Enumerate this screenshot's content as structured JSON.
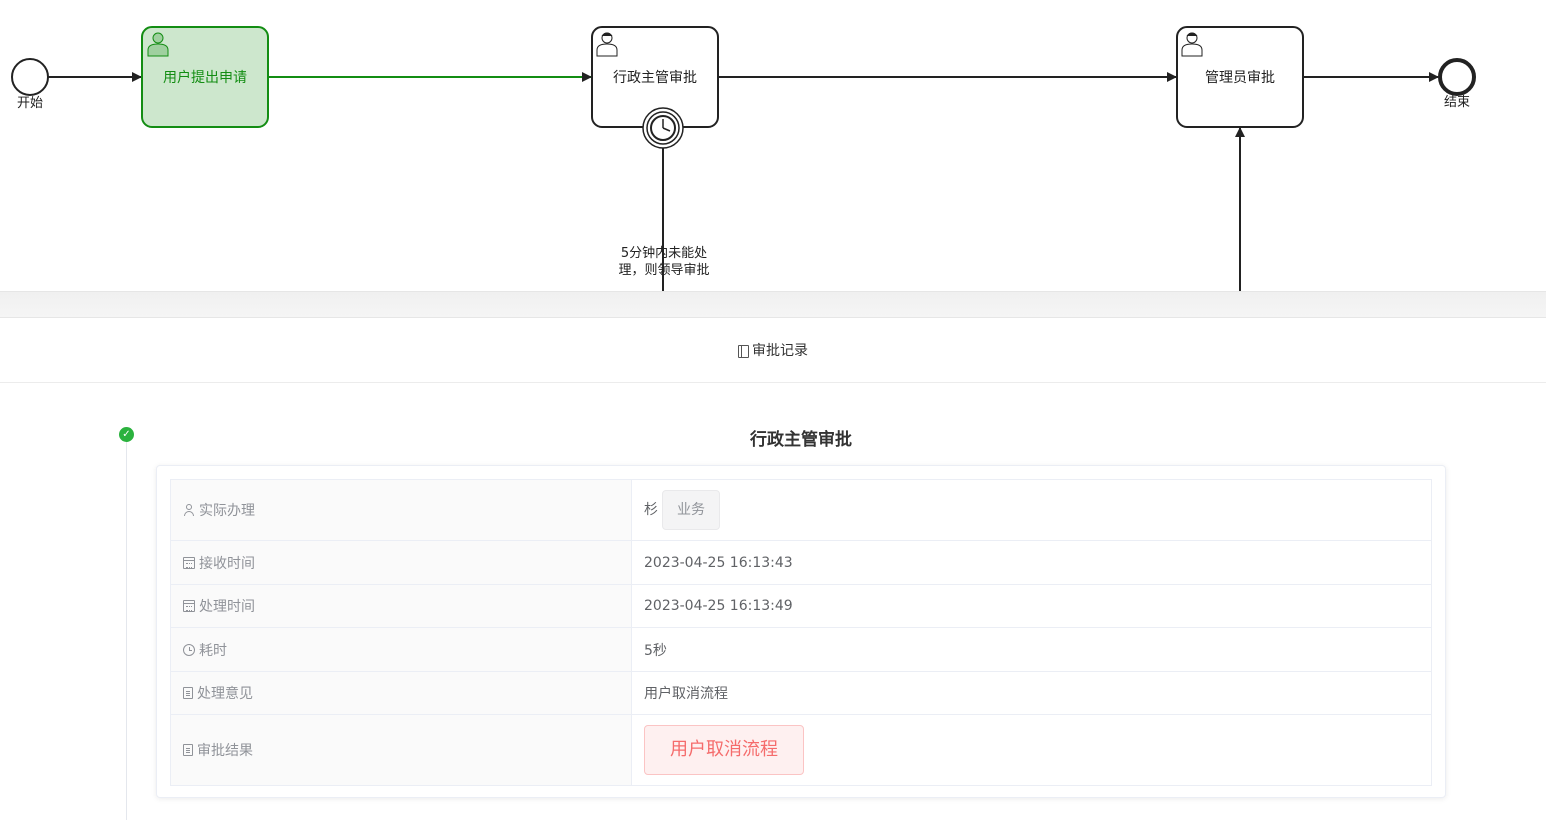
{
  "diagram": {
    "start_label": "开始",
    "end_label": "结束",
    "tasks": [
      {
        "label": "用户提出申请",
        "status": "completed"
      },
      {
        "label": "行政主管审批",
        "status": "pending"
      },
      {
        "label": "管理员审批",
        "status": "pending"
      }
    ],
    "timer_flow_label_line1": "5分钟内未能处",
    "timer_flow_label_line2": "理，则领导审批",
    "colors": {
      "completed_fill": "#cde7cd",
      "completed_stroke": "#138d13",
      "stroke": "#222222"
    }
  },
  "record": {
    "header_icon": "document-icon",
    "header": "审批记录",
    "node_title": "行政主管审批",
    "status_icon": "check-circle-icon",
    "rows": {
      "handler_label": "实际办理",
      "handler_name": "杉",
      "handler_dept": "业务",
      "receive_time_label": "接收时间",
      "receive_time": "2023-04-25 16:13:43",
      "process_time_label": "处理时间",
      "process_time": "2023-04-25 16:13:49",
      "duration_label": "耗时",
      "duration": "5秒",
      "opinion_label": "处理意见",
      "opinion": "用户取消流程",
      "result_label": "审批结果",
      "result": "用户取消流程"
    },
    "colors": {
      "success": "#2bb23e",
      "danger": "#f56c6c"
    }
  }
}
